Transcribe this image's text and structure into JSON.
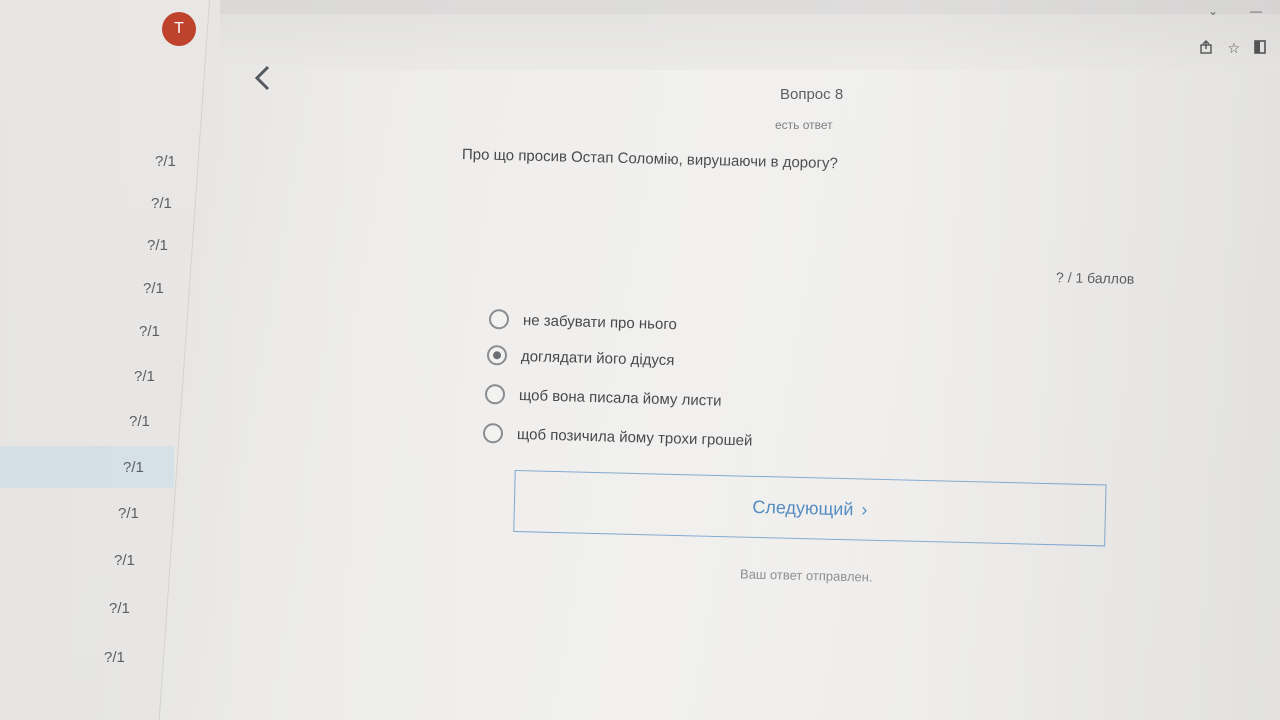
{
  "user": {
    "avatar_initial": "T",
    "avatar_color": "#c0432d"
  },
  "sidebar": {
    "items": [
      {
        "label": "?/1",
        "active": false
      },
      {
        "label": "?/1",
        "active": false
      },
      {
        "label": "?/1",
        "active": false
      },
      {
        "label": "?/1",
        "active": false
      },
      {
        "label": "?/1",
        "active": false
      },
      {
        "label": "?/1",
        "active": false
      },
      {
        "label": "?/1",
        "active": false
      },
      {
        "label": "?/1",
        "active": true
      },
      {
        "label": "?/1",
        "active": false
      },
      {
        "label": "?/1",
        "active": false
      },
      {
        "label": "?/1",
        "active": false
      },
      {
        "label": "?/1",
        "active": false
      }
    ]
  },
  "question": {
    "title": "Вопрос 8",
    "status": "есть ответ",
    "text": "Про що просив Остап Соломію, вирушаючи в дорогу?",
    "score": "?  /  1  баллов",
    "options": [
      {
        "label": "не забувати про нього",
        "selected": false
      },
      {
        "label": "доглядати його дідуся",
        "selected": true
      },
      {
        "label": "щоб вона писала йому листи",
        "selected": false
      },
      {
        "label": "щоб позичила йому трохи  грошей",
        "selected": false
      }
    ]
  },
  "actions": {
    "next_label": "Следующий",
    "next_icon": "chevron-right-icon"
  },
  "footer": {
    "submitted": "Ваш ответ отправлен."
  },
  "colors": {
    "accent": "#4f88bf",
    "active_item": "#d8e4ea"
  }
}
